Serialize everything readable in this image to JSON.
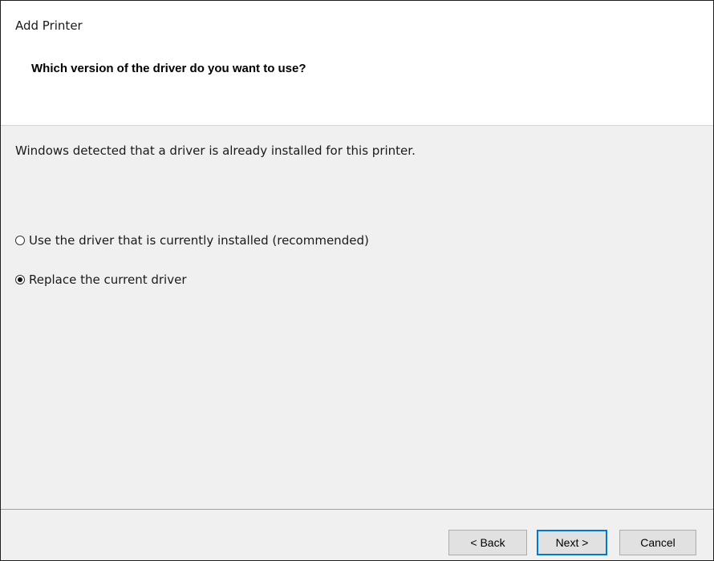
{
  "window": {
    "title": "Add Printer"
  },
  "header": {
    "question": "Which version of the driver do you want to use?"
  },
  "content": {
    "info": "Windows detected that a driver is already installed for this printer.",
    "options": [
      {
        "label": "Use the driver that is currently installed (recommended)",
        "selected": false
      },
      {
        "label": "Replace the current driver",
        "selected": true
      }
    ]
  },
  "footer": {
    "back_label": "< Back",
    "next_label": "Next >",
    "cancel_label": "Cancel"
  },
  "colors": {
    "focus_border": "#0078d7",
    "panel_bg": "#f0f0f0",
    "header_bg": "#ffffff"
  }
}
